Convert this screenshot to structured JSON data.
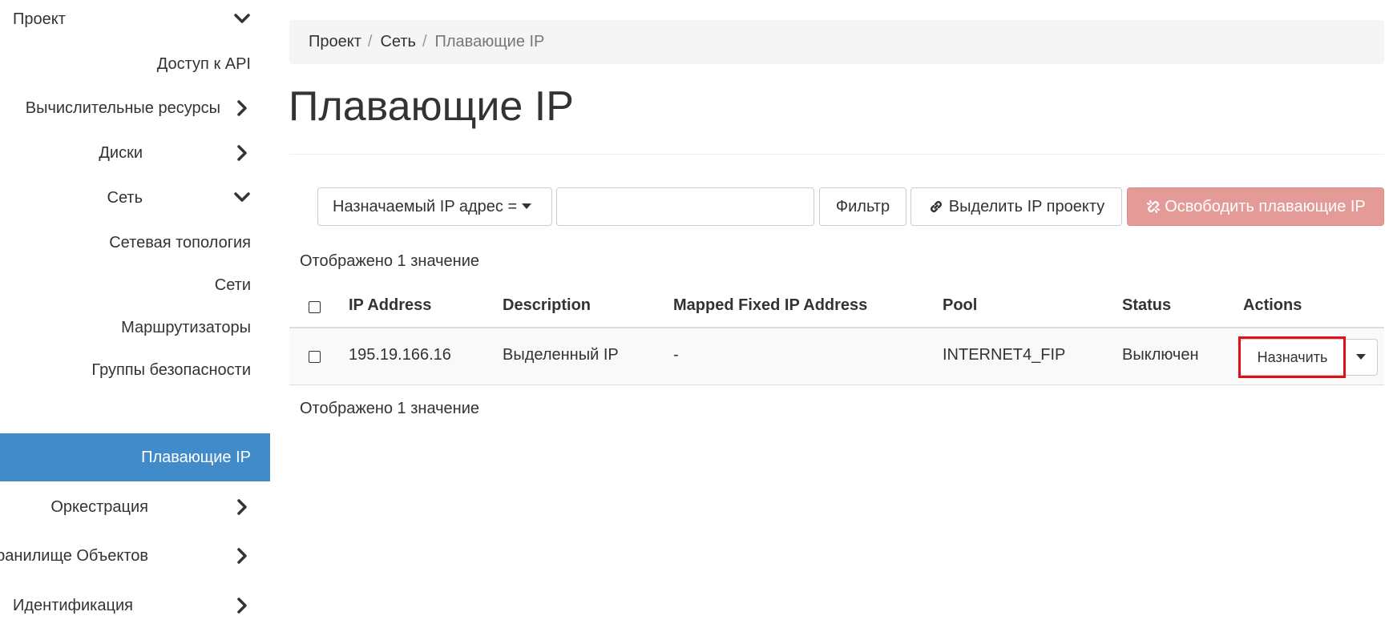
{
  "sidebar": {
    "items": [
      {
        "label": "Проект",
        "chevron": "down"
      },
      {
        "label": "Доступ к API"
      },
      {
        "label": "Вычислительные ресурсы",
        "chevron": "right"
      },
      {
        "label": "Диски",
        "chevron": "right"
      },
      {
        "label": "Сеть",
        "chevron": "down"
      },
      {
        "label": "Сетевая топология"
      },
      {
        "label": "Сети"
      },
      {
        "label": "Маршрутизаторы"
      },
      {
        "label": "Группы безопасности"
      },
      {
        "label": "Плавающие IP",
        "active": true
      },
      {
        "label": "Оркестрация",
        "chevron": "right"
      },
      {
        "label": "Хранилище Объектов",
        "chevron": "right"
      },
      {
        "label": "Идентификация",
        "chevron": "right"
      }
    ]
  },
  "breadcrumb": [
    "Проект",
    "Сеть",
    "Плавающие IP"
  ],
  "page": {
    "title": "Плавающие IP"
  },
  "toolbar": {
    "filter_field": "Назначаемый IP адрес =",
    "filter_value": "",
    "filter_button": "Фильтр",
    "allocate_button": "Выделить IP проекту",
    "release_button": "Освободить плавающие IP"
  },
  "summary_top": "Отображено 1 значение",
  "summary_bottom": "Отображено 1 значение",
  "table": {
    "columns": [
      "IP Address",
      "Description",
      "Mapped Fixed IP Address",
      "Pool",
      "Status",
      "Actions"
    ],
    "rows": [
      {
        "ip": "195.19.166.16",
        "description": "Выделенный IP",
        "mapped": "-",
        "pool": "INTERNET4_FIP",
        "status": "Выключен",
        "action": "Назначить"
      }
    ]
  },
  "colors": {
    "active_nav": "#428bca",
    "danger_button": "#e49a97",
    "highlight": "#e0101a"
  }
}
